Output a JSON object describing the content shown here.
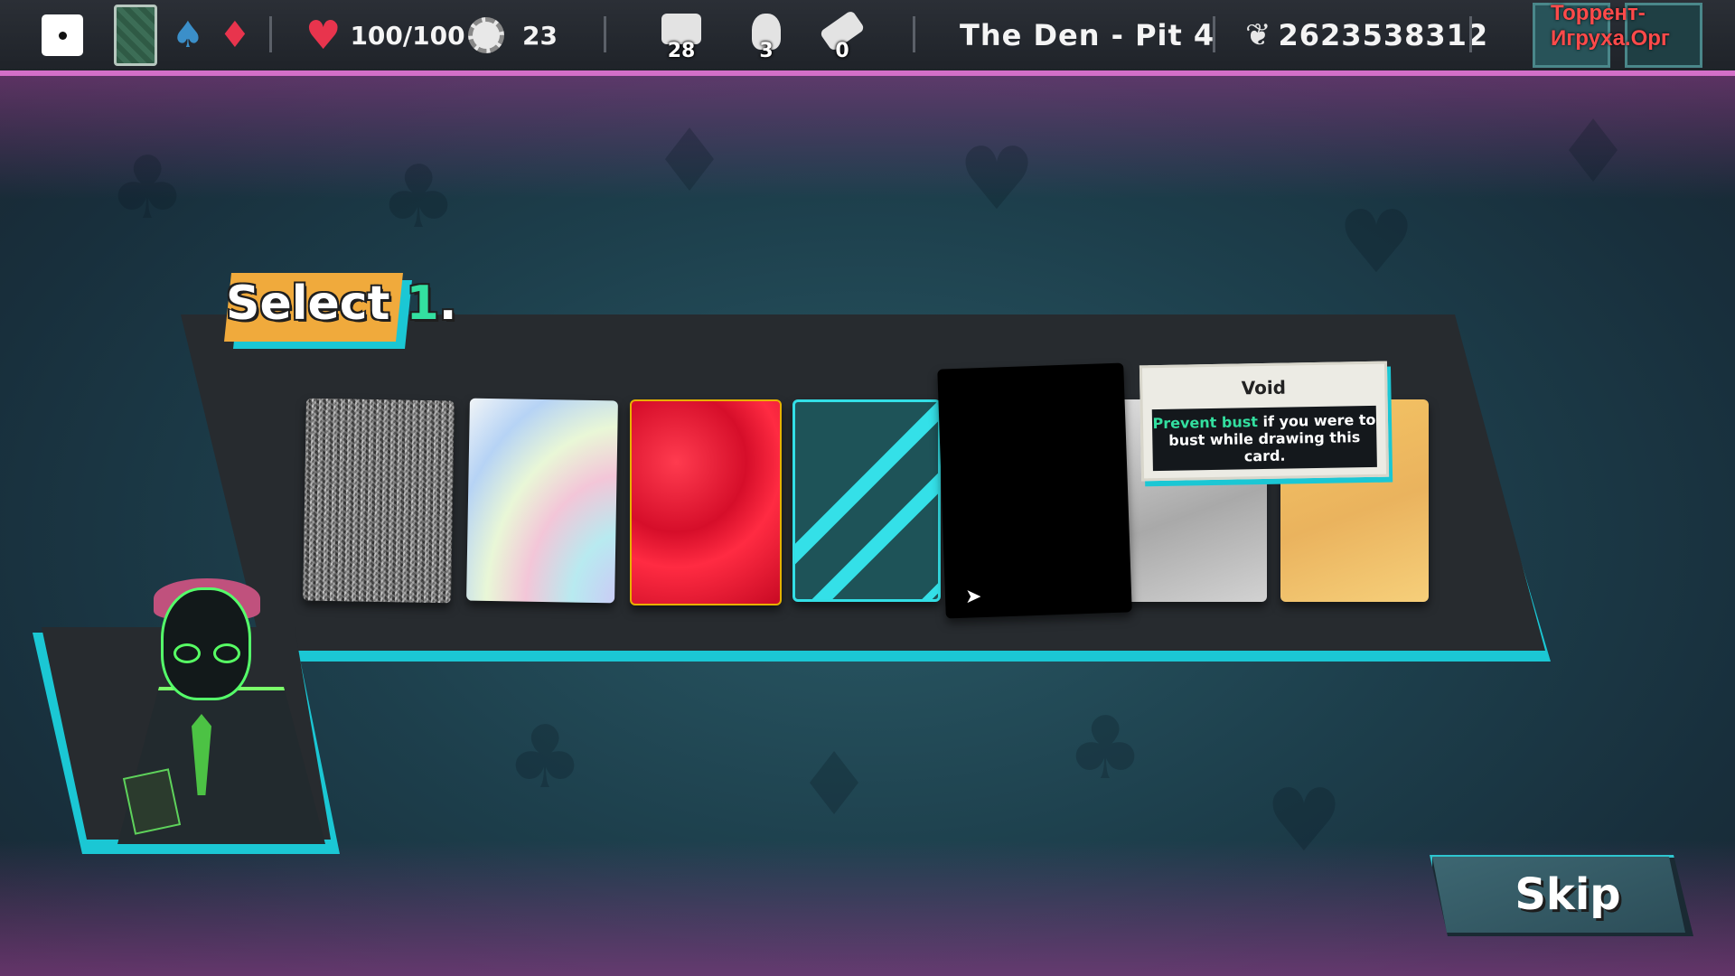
{
  "topbar": {
    "health": "100/100",
    "chips": "23",
    "deck_count": "28",
    "bag_count": "3",
    "ticket_count": "0",
    "location": "The Den - Pit 4",
    "seed": "2623538312",
    "watermark": "Торрент-Игруха.Орг"
  },
  "prompt": {
    "select_word": "Select",
    "select_number": "1",
    "select_period": "."
  },
  "cards": [
    {
      "id": "static"
    },
    {
      "id": "holographic"
    },
    {
      "id": "red"
    },
    {
      "id": "teal-striped"
    },
    {
      "id": "void"
    },
    {
      "id": "silver"
    },
    {
      "id": "gold"
    }
  ],
  "tooltip": {
    "title": "Void",
    "highlight": "Prevent bust",
    "body": " if you were to bust while drawing this card."
  },
  "skip_label": "Skip",
  "colors": {
    "accent_cyan": "#1bc7d4",
    "accent_pink": "#d36fc8",
    "select_tag": "#f0aa3c",
    "highlight_green": "#33e0a0"
  },
  "icons": [
    "dice-icon",
    "deck-back-icon",
    "spade-icon",
    "diamond-icon",
    "heart-icon",
    "chip-icon",
    "cards-icon",
    "bag-icon",
    "ticket-icon",
    "sprout-icon",
    "gear-icon"
  ]
}
